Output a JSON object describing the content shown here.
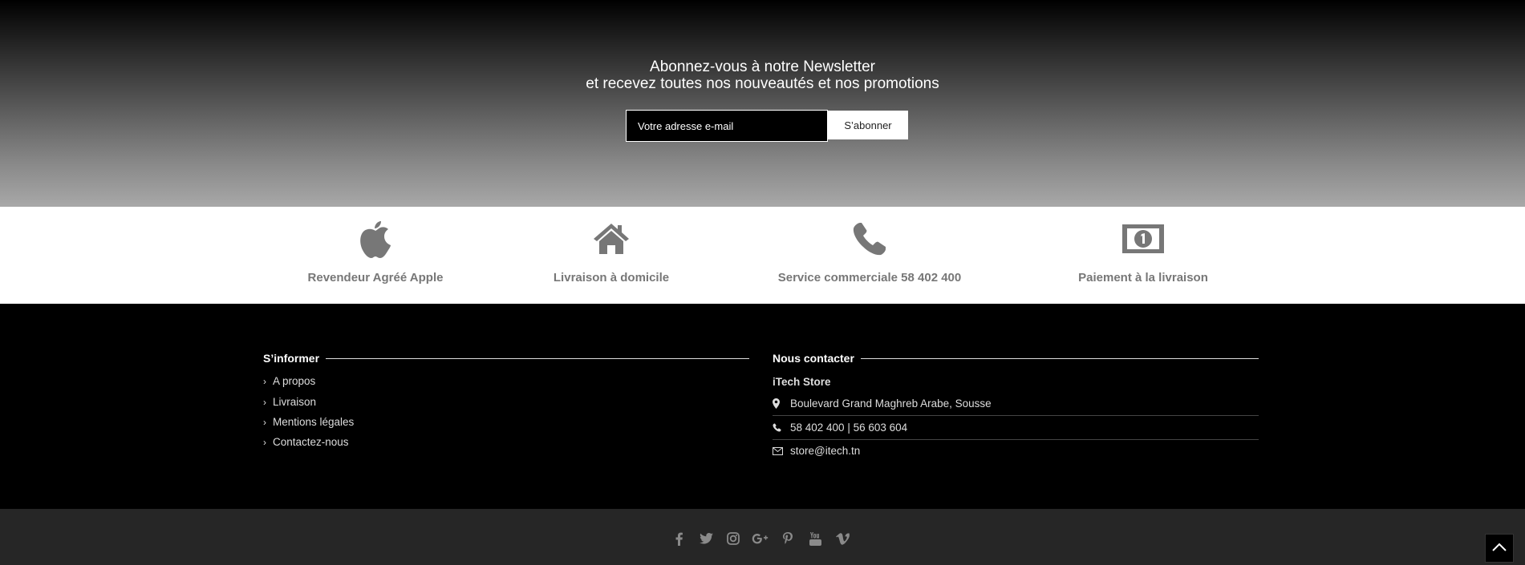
{
  "newsletter": {
    "line1": "Abonnez-vous à notre Newsletter",
    "line2": "et recevez toutes nos nouveautés et nos promotions",
    "placeholder": "Votre adresse e-mail",
    "button": "S’abonner"
  },
  "features": [
    {
      "icon": "apple-icon",
      "label": "Revendeur Agréé Apple"
    },
    {
      "icon": "home-icon",
      "label": "Livraison à domicile"
    },
    {
      "icon": "phone-icon",
      "label": "Service commerciale 58 402 400"
    },
    {
      "icon": "money-icon",
      "label": "Paiement à la livraison"
    }
  ],
  "footer": {
    "inform": {
      "title": "S’informer",
      "links": [
        "A propos",
        "Livraison",
        "Mentions légales",
        "Contactez-nous"
      ]
    },
    "contact": {
      "title": "Nous contacter",
      "name": "iTech Store",
      "address": "Boulevard Grand Maghreb Arabe, Sousse",
      "phone": "58 402 400 | 56 603 604",
      "email": "store@itech.tn"
    }
  },
  "social": [
    "facebook-icon",
    "twitter-icon",
    "instagram-icon",
    "google-plus-icon",
    "pinterest-icon",
    "youtube-icon",
    "vimeo-icon"
  ],
  "colors": {
    "feature_icon": "#777777",
    "feature_text": "#777777",
    "footer_bg": "#000000",
    "bottom_bg": "#262626"
  }
}
